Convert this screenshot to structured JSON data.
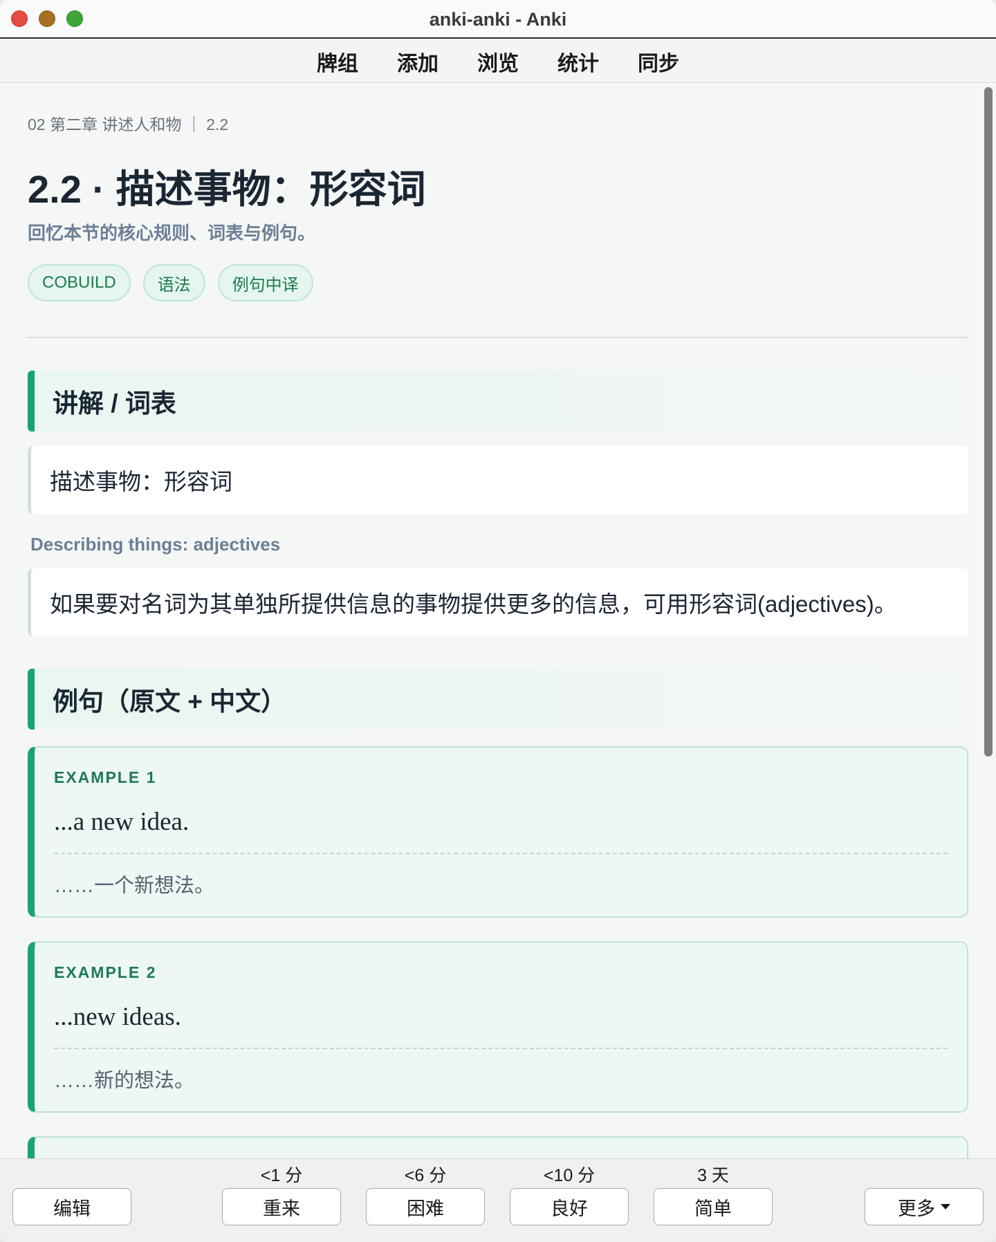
{
  "window": {
    "title": "anki-anki - Anki"
  },
  "toolbar": {
    "items": [
      "牌组",
      "添加",
      "浏览",
      "统计",
      "同步"
    ]
  },
  "card": {
    "breadcrumb": "02 第二章 讲述人和物 ｜ 2.2",
    "title": "2.2 · 描述事物：形容词",
    "subtitle": "回忆本节的核心规则、词表与例句。",
    "tags": [
      "COBUILD",
      "语法",
      "例句中译"
    ],
    "section1": {
      "heading": "讲解 / 词表",
      "term": "描述事物：形容词",
      "en_label": "Describing things: adjectives",
      "explanation": "如果要对名词为其单独所提供信息的事物提供更多的信息，可用形容词(adjectives)。"
    },
    "section2": {
      "heading": "例句（原文 + 中文）",
      "examples": [
        {
          "label": "EXAMPLE 1",
          "en": "...a new idea.",
          "zh": "……一个新想法。"
        },
        {
          "label": "EXAMPLE 2",
          "en": "...new ideas.",
          "zh": "……新的想法。"
        }
      ]
    }
  },
  "answer_bar": {
    "edit_label": "编辑",
    "more_label": "更多",
    "buttons": [
      {
        "interval": "<1 分",
        "label": "重来"
      },
      {
        "interval": "<6 分",
        "label": "困难"
      },
      {
        "interval": "<10 分",
        "label": "良好"
      },
      {
        "interval": "3 天",
        "label": "简单"
      }
    ]
  },
  "colors": {
    "accent": "#18a56e",
    "tag_text": "#1c7a52",
    "example_bg": "#edf7f3"
  }
}
